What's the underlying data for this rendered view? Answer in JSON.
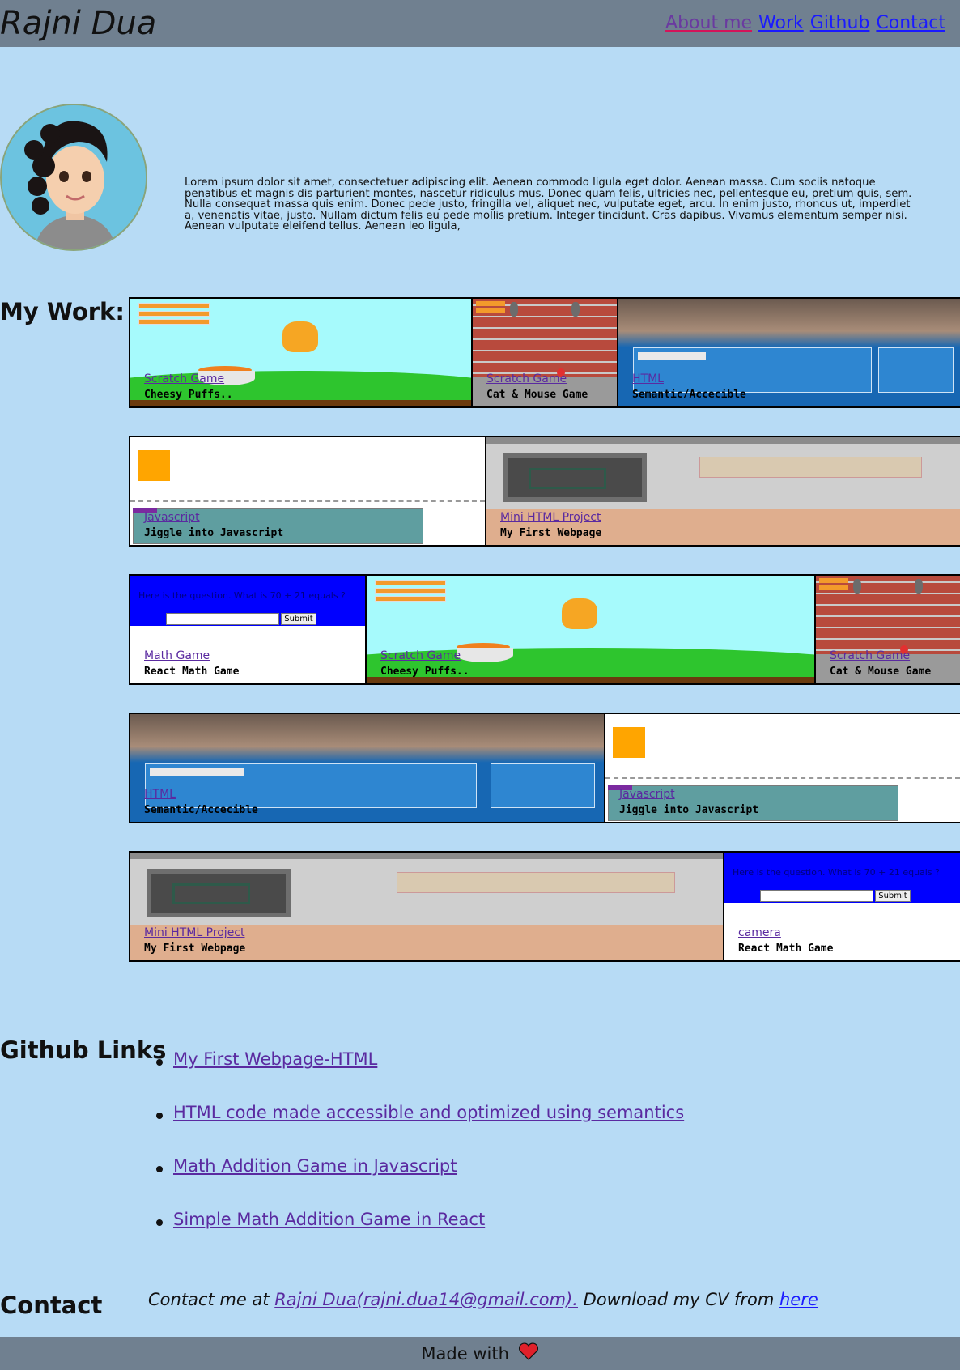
{
  "header": {
    "brand": "Rajni Dua",
    "nav": [
      {
        "label": "About me"
      },
      {
        "label": "Work"
      },
      {
        "label": "Github"
      },
      {
        "label": "Contact"
      }
    ]
  },
  "about": {
    "text": "Lorem ipsum dolor sit amet, consectetuer adipiscing elit. Aenean commodo ligula eget dolor. Aenean massa. Cum sociis natoque penatibus et magnis dis parturient montes, nascetur ridiculus mus. Donec quam felis, ultricies nec, pellentesque eu, pretium quis, sem. Nulla consequat massa quis enim. Donec pede justo, fringilla vel, aliquet nec, vulputate eget, arcu. In enim justo, rhoncus ut, imperdiet a, venenatis vitae, justo. Nullam dictum felis eu pede mollis pretium. Integer tincidunt. Cras dapibus. Vivamus elementum semper nisi. Aenean vulputate eleifend tellus. Aenean leo ligula,"
  },
  "work": {
    "title": "My Work:",
    "rows": [
      [
        {
          "link": "Scratch Game",
          "title": "Cheesy Puffs..",
          "scene": "scratch"
        },
        {
          "link": "Scratch Game",
          "title": "Cat & Mouse Game",
          "scene": "brick"
        },
        {
          "link": "HTML",
          "title": "Semantic/Accecible",
          "scene": "photo"
        }
      ],
      [
        {
          "link": "Javascript",
          "title": "Jiggle into Javascript",
          "scene": "js"
        },
        {
          "link": "Mini HTML Project",
          "title": "My First Webpage",
          "scene": "html"
        }
      ],
      [
        {
          "link": "Math Game",
          "title": "React Math Game",
          "scene": "math"
        },
        {
          "link": "Scratch Game",
          "title": "Cheesy Puffs..",
          "scene": "scratch"
        },
        {
          "link": "Scratch Game",
          "title": "Cat & Mouse Game",
          "scene": "brick"
        }
      ],
      [
        {
          "link": "HTML",
          "title": "Semantic/Accecible",
          "scene": "photo"
        },
        {
          "link": "Javascript",
          "title": "Jiggle into Javascript",
          "scene": "js"
        }
      ],
      [
        {
          "link": "Mini HTML Project",
          "title": "My First Webpage",
          "scene": "html"
        },
        {
          "link": "camera",
          "title": "React Math Game",
          "scene": "math"
        }
      ]
    ],
    "math_question": "Here is the question. What is 70 + 21 equals ?",
    "math_submit": "Submit"
  },
  "github": {
    "title": "Github Links",
    "links": [
      {
        "label": "My First Webpage-HTML"
      },
      {
        "label": "HTML code made accessible and optimized using semantics"
      },
      {
        "label": "Math Addition Game in Javascript"
      },
      {
        "label": "Simple Math Addition Game in React"
      }
    ]
  },
  "contact": {
    "title": "Contact",
    "prefix": "Contact me at ",
    "email_link": "Rajni Dua(rajni.dua14@gmail.com).",
    "middle": " Download my CV from ",
    "cv_link": "here"
  },
  "footer": {
    "text": "Made with",
    "icon": "heart-icon",
    "heart_color": "#e0202a"
  },
  "colors": {
    "background": "#b7dbf5",
    "bars": "#708090"
  }
}
